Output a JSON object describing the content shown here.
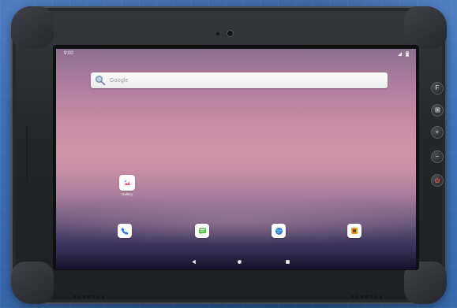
{
  "device": {
    "brand_color": "#25282b",
    "screen": {
      "status": {
        "time": "9:00",
        "signal_icon": "signal-icon",
        "battery_icon": "battery-icon"
      },
      "search": {
        "placeholder": "Google",
        "icon": "search-icon"
      },
      "home_apps": [
        {
          "label": "Gallery",
          "icon": "gallery-icon"
        }
      ],
      "dock_apps": [
        {
          "name": "Phone",
          "icon": "phone-icon"
        },
        {
          "name": "Messages",
          "icon": "messages-icon"
        },
        {
          "name": "Browser",
          "icon": "browser-icon"
        },
        {
          "name": "Camera",
          "icon": "camera-icon"
        }
      ],
      "nav_buttons": [
        {
          "name": "Back",
          "icon": "back-icon"
        },
        {
          "name": "Home",
          "icon": "home-icon"
        },
        {
          "name": "Recents",
          "icon": "recents-icon"
        }
      ]
    },
    "side_buttons": [
      {
        "label": "F",
        "icon": "function-button-icon"
      },
      {
        "label": "",
        "icon": "menu-button-icon"
      },
      {
        "label": "+",
        "icon": "volume-up-icon"
      },
      {
        "label": "−",
        "icon": "volume-down-icon"
      },
      {
        "label": "",
        "icon": "power-icon",
        "color": "#ff4a4a"
      }
    ]
  }
}
